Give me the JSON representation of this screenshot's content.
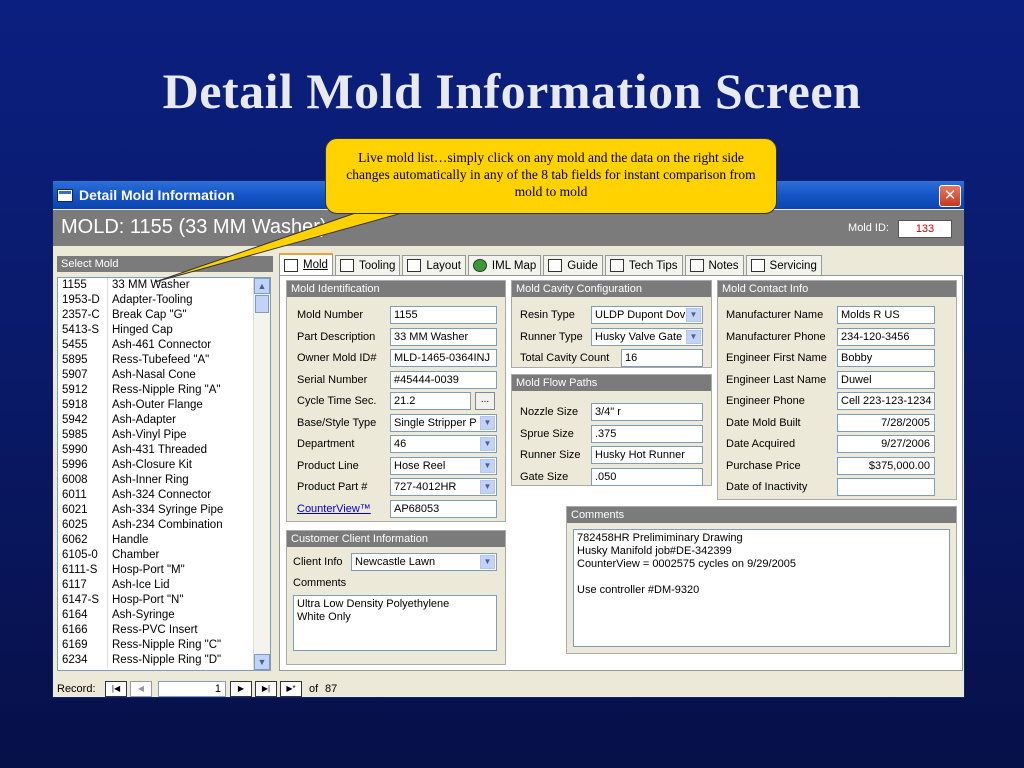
{
  "slide": {
    "title": "Detail Mold Information Screen",
    "callout": "Live mold list…simply click on any mold and the data on the right side changes automatically in any of the 8 tab fields for instant comparison from mold to mold"
  },
  "window": {
    "title": "Detail Mold Information",
    "close_label": "✕",
    "mold_header": "MOLD: 1155  (33 MM Washer)",
    "mold_id_label": "Mold ID:",
    "mold_id_value": "133"
  },
  "colors": {
    "title_bar": "#1455c7",
    "header_gray": "#7b7b7b",
    "callout": "#ffd200",
    "window_bg": "#ece9d8"
  },
  "select_mold": {
    "header": "Select Mold",
    "rows": [
      [
        "1155",
        "33 MM Washer"
      ],
      [
        "1953-D",
        "Adapter-Tooling"
      ],
      [
        "2357-C",
        "Break Cap \"G\""
      ],
      [
        "5413-S",
        "Hinged Cap"
      ],
      [
        "5455",
        "Ash-461 Connector"
      ],
      [
        "5895",
        "Ress-Tubefeed \"A\""
      ],
      [
        "5907",
        "Ash-Nasal Cone"
      ],
      [
        "5912",
        "Ress-Nipple Ring \"A\""
      ],
      [
        "5918",
        "Ash-Outer Flange"
      ],
      [
        "5942",
        "Ash-Adapter"
      ],
      [
        "5985",
        "Ash-Vinyl Pipe"
      ],
      [
        "5990",
        "Ash-431 Threaded"
      ],
      [
        "5996",
        "Ash-Closure Kit"
      ],
      [
        "6008",
        "Ash-Inner Ring"
      ],
      [
        "6011",
        "Ash-324 Connector"
      ],
      [
        "6021",
        "Ash-334 Syringe Pipe"
      ],
      [
        "6025",
        "Ash-234 Combination"
      ],
      [
        "6062",
        "Handle"
      ],
      [
        "6105-0",
        "Chamber"
      ],
      [
        "6111-S",
        "Hosp-Port \"M\""
      ],
      [
        "6117",
        "Ash-Ice Lid"
      ],
      [
        "6147-S",
        "Hosp-Port \"N\""
      ],
      [
        "6164",
        "Ash-Syringe"
      ],
      [
        "6166",
        "Ress-PVC Insert"
      ],
      [
        "6169",
        "Ress-Nipple Ring \"C\""
      ],
      [
        "6234",
        "Ress-Nipple Ring \"D\""
      ]
    ]
  },
  "tabs": [
    "Mold",
    "Tooling",
    "Layout",
    "IML Map",
    "Guide",
    "Tech Tips",
    "Notes",
    "Servicing"
  ],
  "mold_identification": {
    "header": "Mold Identification",
    "fields": [
      {
        "label": "Mold Number",
        "value": "1155"
      },
      {
        "label": "Part Description",
        "value": "33 MM Washer"
      },
      {
        "label": "Owner Mold ID#",
        "value": "MLD-1465-0364INJ"
      },
      {
        "label": "Serial Number",
        "value": "#45444-0039"
      },
      {
        "label": "Cycle Time Sec.",
        "value": "21.2"
      },
      {
        "label": "Base/Style Type",
        "value": "Single Stripper P"
      },
      {
        "label": "Department",
        "value": "46"
      },
      {
        "label": "Product Line",
        "value": "Hose Reel"
      },
      {
        "label": "Product Part #",
        "value": "727-4012HR"
      },
      {
        "label": "CounterView™",
        "value": "AP68053"
      }
    ],
    "ellipsis": "..."
  },
  "cavity_config": {
    "header": "Mold Cavity Configuration",
    "fields": [
      {
        "label": "Resin Type",
        "value": "ULDP Dupont Dov"
      },
      {
        "label": "Runner Type",
        "value": "Husky Valve Gate"
      },
      {
        "label": "Total Cavity Count",
        "value": "16"
      }
    ]
  },
  "flow_paths": {
    "header": "Mold Flow Paths",
    "fields": [
      {
        "label": "Nozzle Size",
        "value": "3/4\" r"
      },
      {
        "label": "Sprue Size",
        "value": ".375"
      },
      {
        "label": "Runner Size",
        "value": "Husky Hot Runner"
      },
      {
        "label": "Gate Size",
        "value": ".050"
      }
    ]
  },
  "contact_info": {
    "header": "Mold Contact Info",
    "fields": [
      {
        "label": "Manufacturer Name",
        "value": "Molds R US"
      },
      {
        "label": "Manufacturer Phone",
        "value": "234-120-3456"
      },
      {
        "label": "Engineer First Name",
        "value": "Bobby"
      },
      {
        "label": "Engineer Last Name",
        "value": "Duwel"
      },
      {
        "label": "Engineer Phone",
        "value": "Cell 223-123-1234"
      },
      {
        "label": "Date Mold Built",
        "value": "7/28/2005"
      },
      {
        "label": "Date Acquired",
        "value": "9/27/2006"
      },
      {
        "label": "Purchase Price",
        "value": "$375,000.00"
      },
      {
        "label": "Date of Inactivity",
        "value": ""
      }
    ]
  },
  "customer_client": {
    "header": "Customer Client Information",
    "client_label": "Client Info",
    "client_value": "Newcastle Lawn",
    "comments_label": "Comments",
    "comments_text": "Ultra Low Density Polyethylene\nWhite Only"
  },
  "comments": {
    "header": "Comments",
    "text": "782458HR Prelimiminary Drawing\nHusky Manifold job#DE-342399\nCounterView = 0002575 cycles on 9/29/2005\n\nUse controller #DM-9320"
  },
  "record_nav": {
    "label": "Record:",
    "current": "1",
    "of_label": "of",
    "total": "87"
  }
}
